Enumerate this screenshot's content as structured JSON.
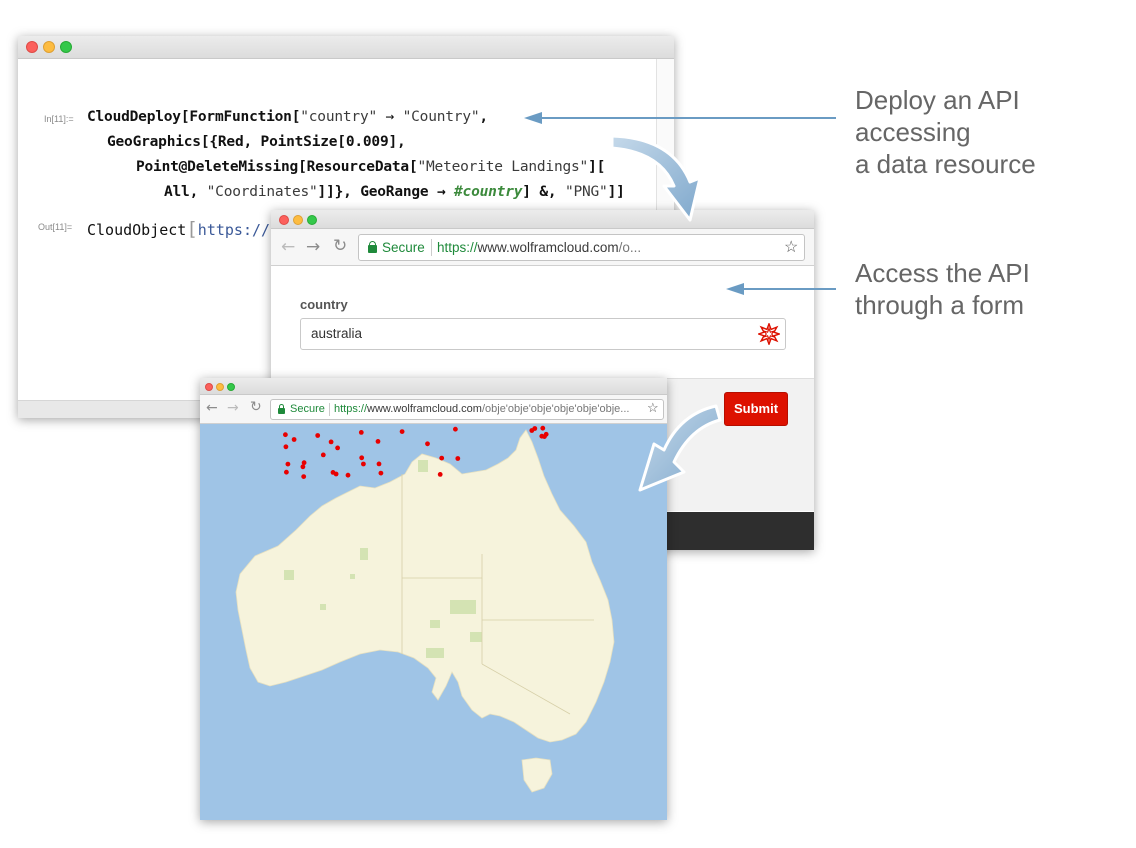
{
  "notebook": {
    "in_label": "In[11]:=",
    "out_label": "Out[11]=",
    "code": {
      "l1_a": "CloudDeploy[FormFunction[",
      "l1_s1": "\"country\"",
      "l1_arrow": " → ",
      "l1_s2": "\"Country\"",
      "l1_b": ",",
      "l2": "GeoGraphics[{Red, PointSize[0.009],",
      "l3_a": "Point@DeleteMissing[ResourceData[",
      "l3_s": "\"Meteorite Landings\"",
      "l3_b": "][",
      "l4_a": "All, ",
      "l4_s": "\"Coordinates\"",
      "l4_b": "]]}, GeoRange → ",
      "l4_var": "#country",
      "l4_c": "] &, ",
      "l4_s2": "\"PNG\"",
      "l4_d": "]]"
    },
    "output": {
      "prefix": "CloudObject",
      "bracket": "[",
      "url": "https://"
    }
  },
  "form_browser": {
    "secure_label": "Secure",
    "url_green": "https://",
    "url_main": "www.wolframcloud.com",
    "url_rest": "/o...",
    "field_label": "country",
    "field_value": "australia",
    "submit_label": "Submit"
  },
  "map_browser": {
    "secure_label": "Secure",
    "url_green": "https://",
    "url_main": "www.wolframcloud.com",
    "url_rest": "/obje'obje'obje'obje'obje'obje..."
  },
  "annotations": {
    "deploy_line1": "Deploy an API accessing",
    "deploy_line2": "a data resource",
    "access_line1": "Access the API",
    "access_line2": "through a form"
  },
  "colors": {
    "ocean": "#9fc4e6",
    "land": "#f6f3dc",
    "park": "#d4e3b3",
    "point": "#e80000",
    "submit": "#dd1100",
    "arrow": "#6a9bc3"
  },
  "icons": [
    "back-arrow-icon",
    "forward-arrow-icon",
    "reload-icon",
    "lock-icon",
    "star-icon",
    "wolfram-spikey-icon"
  ]
}
